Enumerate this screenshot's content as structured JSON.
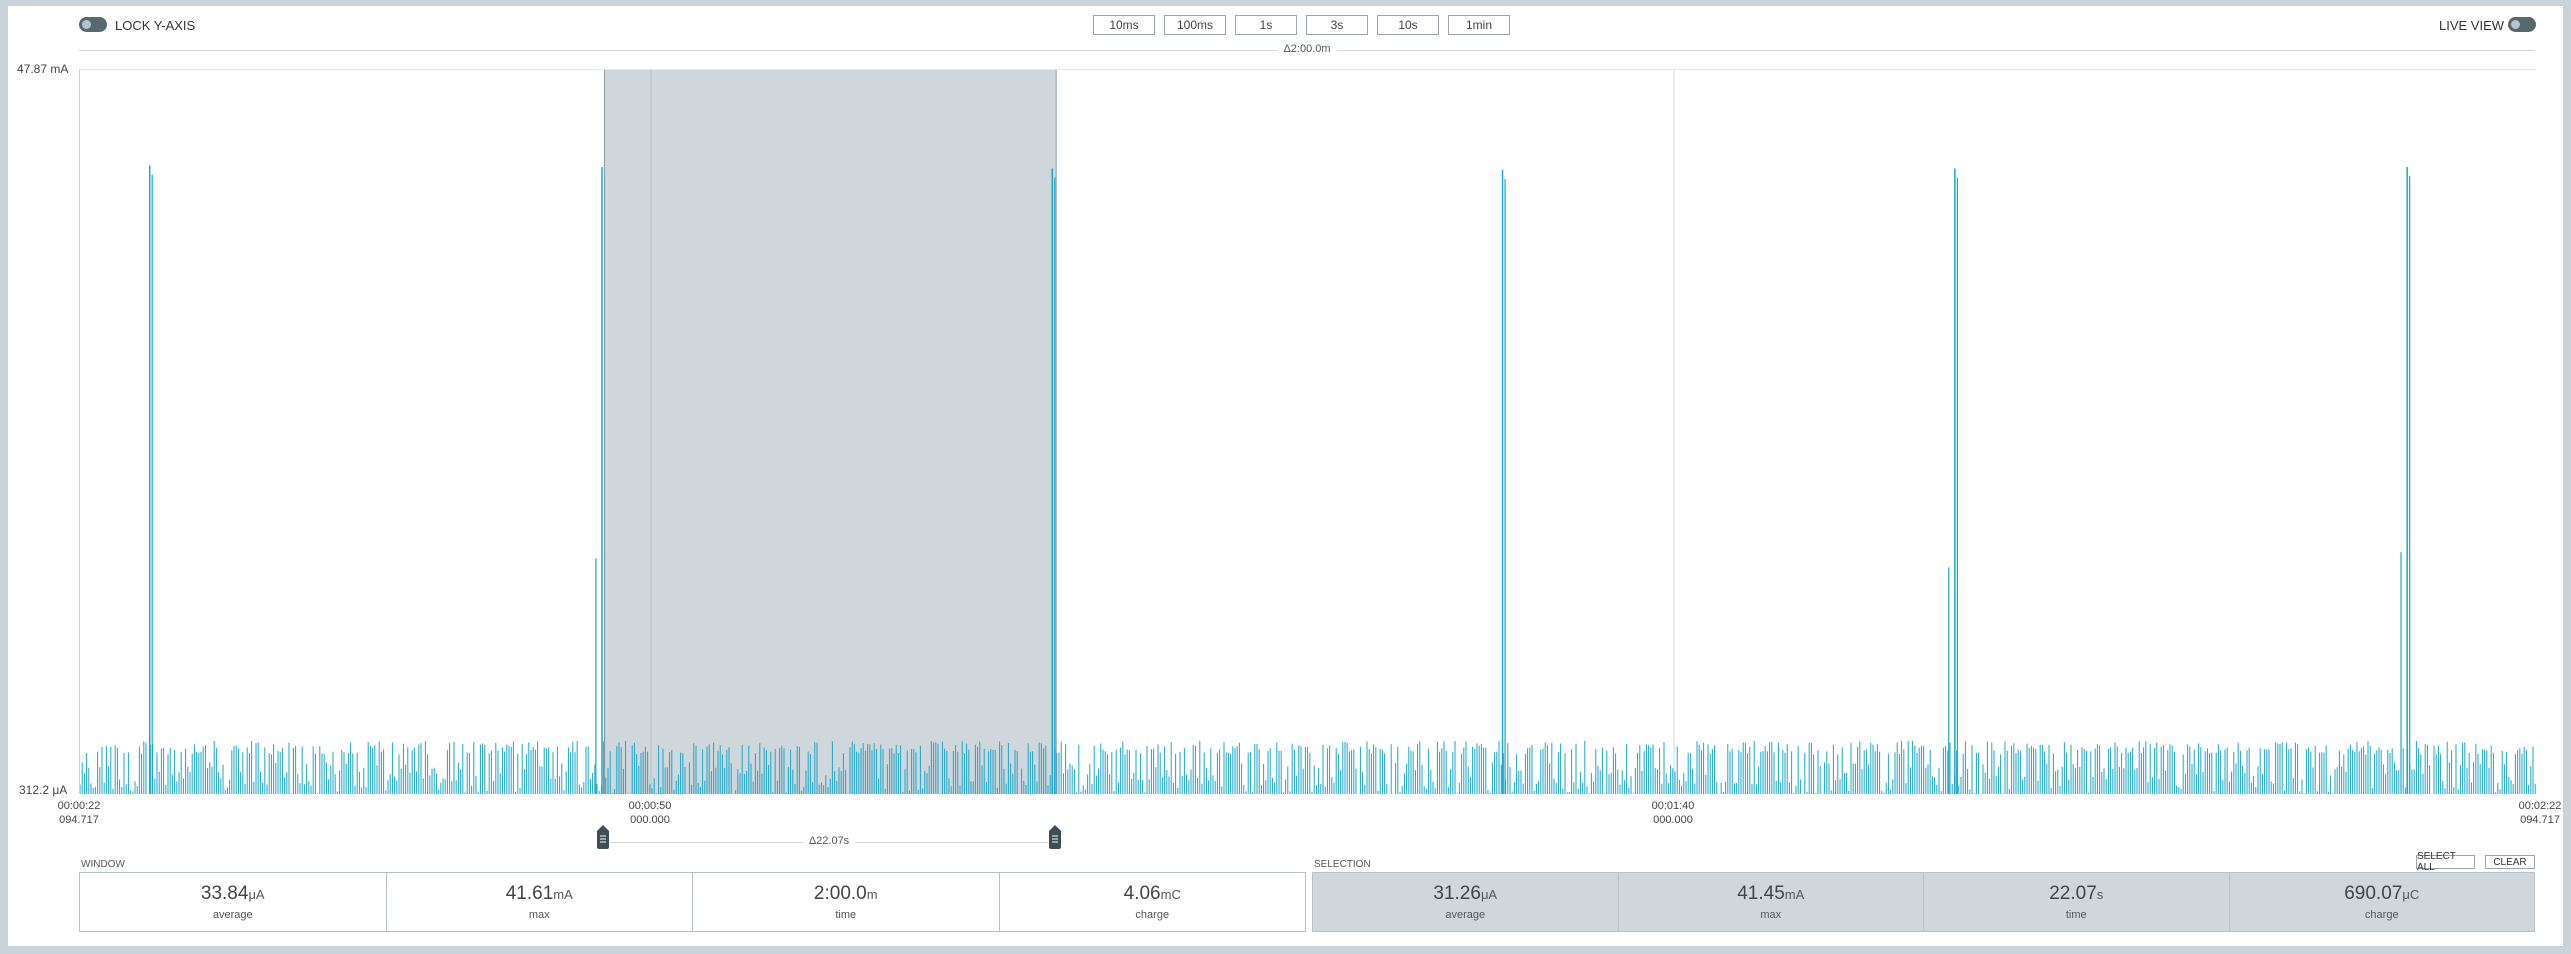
{
  "toolbar": {
    "lock_y_axis_label": "LOCK Y-AXIS",
    "live_view_label": "LIVE VIEW",
    "zoom_buttons": [
      "10ms",
      "100ms",
      "1s",
      "3s",
      "10s",
      "1min"
    ]
  },
  "window_span": "Δ2:00.0m",
  "y_axis": {
    "max_label": "47.87 mA",
    "min_label": "312.2 μA"
  },
  "time_labels": [
    {
      "time": "00:00:22",
      "sub": "094.717"
    },
    {
      "time": "00:00:50",
      "sub": "000.000"
    },
    {
      "time": "00:01:40",
      "sub": "000.000"
    },
    {
      "time": "00:02:22",
      "sub": "094.717"
    }
  ],
  "selection_span": "Δ22.07s",
  "window_stats": {
    "title": "WINDOW",
    "items": [
      {
        "value": "33.84",
        "unit": "μA",
        "label": "average"
      },
      {
        "value": "41.61",
        "unit": "mA",
        "label": "max"
      },
      {
        "value": "2:00.0",
        "unit": "m",
        "label": "time"
      },
      {
        "value": "4.06",
        "unit": "mC",
        "label": "charge"
      }
    ]
  },
  "selection_stats": {
    "title": "SELECTION",
    "select_all_label": "SELECT ALL",
    "clear_label": "CLEAR",
    "items": [
      {
        "value": "31.26",
        "unit": "μA",
        "label": "average"
      },
      {
        "value": "41.45",
        "unit": "mA",
        "label": "max"
      },
      {
        "value": "22.07",
        "unit": "s",
        "label": "time"
      },
      {
        "value": "690.07",
        "unit": "μC",
        "label": "charge"
      }
    ]
  },
  "colors": {
    "trace": "#1ea7c8",
    "selection_fill": "#cfd7dd",
    "toggle": "#58686f"
  },
  "chart_data": {
    "type": "line",
    "x_range_seconds": [
      22.094717,
      142.094717
    ],
    "y_range_mA": [
      0.3122,
      47.87
    ],
    "selection_seconds": [
      47.72,
      69.79
    ],
    "spikes": [
      {
        "t": 25.5,
        "mA": 41.6
      },
      {
        "t": 47.6,
        "mA": 41.5
      },
      {
        "t": 69.6,
        "mA": 41.4
      },
      {
        "t": 91.6,
        "mA": 41.3
      },
      {
        "t": 113.7,
        "mA": 41.4
      },
      {
        "t": 135.8,
        "mA": 41.5
      }
    ],
    "pre_spikes": [
      {
        "t": 47.3,
        "mA": 15.8
      },
      {
        "t": 113.4,
        "mA": 15.2
      },
      {
        "t": 135.5,
        "mA": 16.2
      }
    ],
    "baseline_noise_mA": [
      0.3,
      3.8
    ]
  }
}
